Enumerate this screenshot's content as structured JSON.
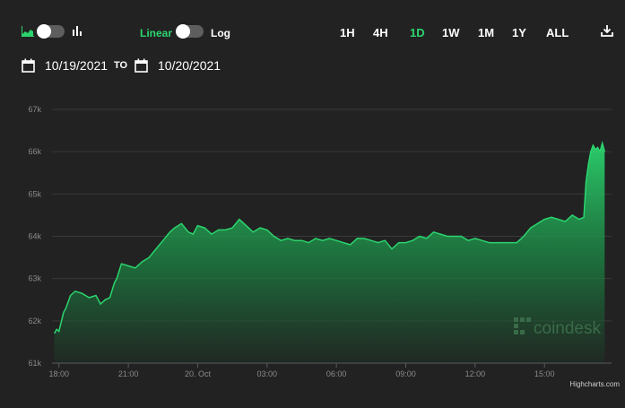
{
  "toolbar": {
    "chart_icons": [
      "area-chart-icon",
      "bar-chart-icon"
    ],
    "linear_label": "Linear",
    "log_label": "Log",
    "ranges": [
      "1H",
      "4H",
      "1D",
      "1W",
      "1M",
      "1Y",
      "ALL"
    ],
    "active_range": "1D",
    "download_icon": "download-icon",
    "accent_color": "#2bd46e"
  },
  "date_range": {
    "from": "10/19/2021",
    "to_label": "TO",
    "to": "10/20/2021",
    "calendar_icon": "calendar-icon"
  },
  "watermark": "coindesk",
  "credits": "Highcharts.com",
  "chart_data": {
    "type": "area",
    "ylim": [
      61000,
      67000
    ],
    "yticks": [
      61000,
      62000,
      63000,
      64000,
      65000,
      66000,
      67000
    ],
    "ytick_labels": [
      "61k",
      "62k",
      "63k",
      "64k",
      "65k",
      "66k",
      "67k"
    ],
    "xlim": [
      -0.3,
      23.9
    ],
    "xticks": [
      0,
      3,
      6,
      9,
      12,
      15,
      18,
      21
    ],
    "xtick_labels": [
      "18:00",
      "21:00",
      "20. Oct",
      "03:00",
      "06:00",
      "09:00",
      "12:00",
      "15:00"
    ],
    "line_color": "#2bd46e",
    "grid": true,
    "series": [
      {
        "x": [
          -0.2,
          -0.1,
          0.0,
          0.2,
          0.3,
          0.5,
          0.7,
          1.0,
          1.3,
          1.6,
          1.8,
          2.0,
          2.2,
          2.4,
          2.5,
          2.7,
          3.0,
          3.3,
          3.6,
          3.9,
          4.2,
          4.5,
          4.8,
          5.0,
          5.3,
          5.6,
          5.8,
          6.0,
          6.3,
          6.6,
          6.9,
          7.2,
          7.5,
          7.8,
          8.1,
          8.4,
          8.7,
          9.0,
          9.3,
          9.6,
          9.9,
          10.2,
          10.5,
          10.8,
          11.1,
          11.4,
          11.7,
          12.0,
          12.3,
          12.6,
          12.9,
          13.2,
          13.5,
          13.8,
          14.1,
          14.4,
          14.7,
          15.0,
          15.3,
          15.6,
          15.9,
          16.2,
          16.5,
          16.8,
          17.1,
          17.4,
          17.7,
          18.0,
          18.3,
          18.6,
          18.9,
          19.2,
          19.5,
          19.8,
          20.1,
          20.4,
          20.7,
          21.0,
          21.3,
          21.6,
          21.9,
          22.2,
          22.5,
          22.7,
          22.8,
          22.9,
          23.0,
          23.1,
          23.2,
          23.3,
          23.4,
          23.5,
          23.6
        ],
        "values": [
          61700,
          61800,
          61750,
          62200,
          62300,
          62600,
          62700,
          62650,
          62550,
          62600,
          62400,
          62500,
          62550,
          62900,
          63000,
          63350,
          63300,
          63250,
          63400,
          63500,
          63700,
          63900,
          64100,
          64200,
          64300,
          64100,
          64050,
          64250,
          64200,
          64050,
          64150,
          64150,
          64200,
          64400,
          64250,
          64100,
          64200,
          64150,
          64000,
          63900,
          63950,
          63900,
          63900,
          63850,
          63950,
          63900,
          63950,
          63900,
          63850,
          63800,
          63950,
          63950,
          63900,
          63850,
          63900,
          63700,
          63850,
          63850,
          63900,
          64000,
          63950,
          64100,
          64050,
          64000,
          64000,
          64000,
          63900,
          63950,
          63900,
          63850,
          63850,
          63850,
          63850,
          63850,
          64000,
          64200,
          64300,
          64400,
          64450,
          64400,
          64350,
          64500,
          64400,
          64450,
          65300,
          65700,
          66000,
          66150,
          66050,
          66100,
          66000,
          66200,
          66000
        ]
      }
    ]
  }
}
